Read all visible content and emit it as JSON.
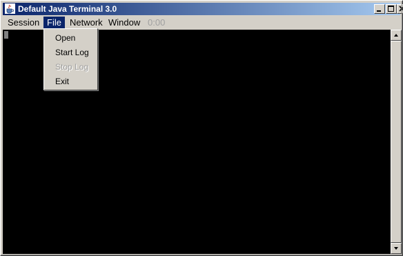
{
  "window": {
    "title": "Default Java Terminal 3.0",
    "icon": "java-cup-icon",
    "controls": [
      "minimize-icon",
      "maximize-icon",
      "close-icon"
    ]
  },
  "menubar": {
    "items": [
      {
        "label": "Session",
        "state": "normal"
      },
      {
        "label": "File",
        "state": "active"
      },
      {
        "label": "Network",
        "state": "normal"
      },
      {
        "label": "Window",
        "state": "normal"
      }
    ],
    "timer": "0:00"
  },
  "file_menu": {
    "items": [
      {
        "label": "Open",
        "enabled": true
      },
      {
        "label": "Start Log",
        "enabled": true
      },
      {
        "label": "Stop Log",
        "enabled": false
      },
      {
        "label": "Exit",
        "enabled": true
      }
    ]
  },
  "colors": {
    "title_gradient_start": "#0a246a",
    "title_gradient_end": "#a6caf0",
    "menu_highlight": "#0a246a",
    "terminal_background": "#000000",
    "cursor": "#808080",
    "disabled_text": "#a0a0a0"
  }
}
